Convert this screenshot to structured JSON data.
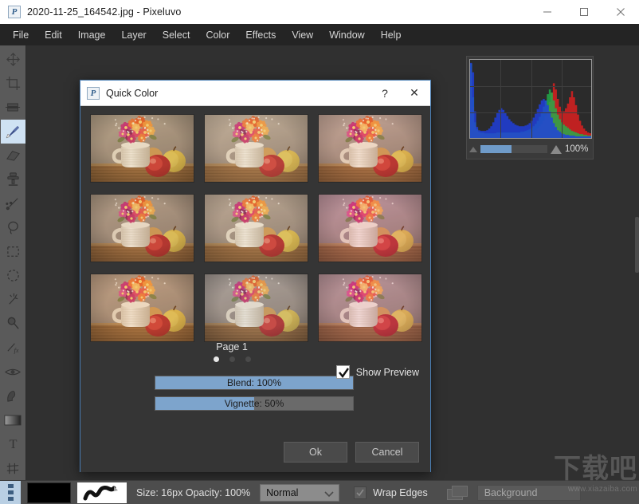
{
  "window": {
    "title": "2020-11-25_164542.jpg - Pixeluvo",
    "app_icon": "P",
    "minimize": "minimize-icon",
    "maximize": "maximize-icon",
    "close": "close-icon"
  },
  "menu": {
    "items": [
      {
        "label": "File"
      },
      {
        "label": "Edit"
      },
      {
        "label": "Image"
      },
      {
        "label": "Layer"
      },
      {
        "label": "Select"
      },
      {
        "label": "Color"
      },
      {
        "label": "Effects"
      },
      {
        "label": "View"
      },
      {
        "label": "Window"
      },
      {
        "label": "Help"
      }
    ]
  },
  "toolbar": {
    "tools": [
      {
        "name": "move-tool",
        "selected": false
      },
      {
        "name": "crop-tool",
        "selected": false
      },
      {
        "name": "transform-tool",
        "selected": false
      },
      {
        "name": "brush-tool",
        "selected": true
      },
      {
        "name": "eraser-tool",
        "selected": false
      },
      {
        "name": "clone-stamp-tool",
        "selected": false
      },
      {
        "name": "healing-tool",
        "selected": false
      },
      {
        "name": "lasso-tool",
        "selected": false
      },
      {
        "name": "rectangle-select-tool",
        "selected": false
      },
      {
        "name": "ellipse-select-tool",
        "selected": false
      },
      {
        "name": "magic-wand-tool",
        "selected": false
      },
      {
        "name": "zoom-tool",
        "selected": false
      },
      {
        "name": "effects-tool",
        "selected": false
      },
      {
        "name": "red-eye-tool",
        "selected": false
      },
      {
        "name": "smudge-tool",
        "selected": false
      },
      {
        "name": "gradient-tool",
        "selected": false
      },
      {
        "name": "text-tool",
        "selected": false
      },
      {
        "name": "path-tool",
        "selected": false
      }
    ]
  },
  "histogram": {
    "zoom_value": "100%",
    "zoom_fill_percent": 47,
    "chart_data": {
      "type": "area",
      "title": "",
      "xlabel": "",
      "ylabel": "",
      "xlim": [
        0,
        255
      ],
      "ylim": [
        0,
        100
      ],
      "grid": true,
      "legend": "none",
      "series": [
        {
          "name": "Red",
          "color": "#e02020",
          "values": [
            88,
            40,
            16,
            9,
            7,
            6,
            6,
            5,
            5,
            5,
            5,
            5,
            6,
            6,
            6,
            6,
            6,
            6,
            6,
            6,
            6,
            6,
            6,
            6,
            6,
            6,
            7,
            7,
            7,
            7,
            8,
            9,
            10,
            12,
            15,
            18,
            22,
            28,
            36,
            46,
            58,
            70,
            62,
            50,
            40,
            34,
            34,
            38,
            44,
            52,
            60,
            52,
            42,
            30,
            22,
            16,
            12,
            9,
            7,
            6
          ]
        },
        {
          "name": "Green",
          "color": "#22b04a",
          "values": [
            95,
            52,
            20,
            11,
            8,
            7,
            7,
            6,
            6,
            6,
            6,
            6,
            6,
            7,
            7,
            7,
            7,
            7,
            7,
            7,
            7,
            7,
            7,
            7,
            7,
            8,
            8,
            9,
            10,
            11,
            13,
            15,
            18,
            22,
            27,
            33,
            40,
            48,
            56,
            62,
            58,
            48,
            38,
            30,
            24,
            20,
            17,
            15,
            13,
            11,
            9,
            8,
            7,
            6,
            5,
            5,
            4,
            4,
            3,
            3
          ]
        },
        {
          "name": "Blue",
          "color": "#2040e0",
          "values": [
            96,
            84,
            34,
            14,
            10,
            9,
            9,
            9,
            10,
            12,
            15,
            20,
            26,
            32,
            36,
            38,
            36,
            32,
            28,
            24,
            21,
            19,
            17,
            16,
            15,
            15,
            15,
            16,
            17,
            19,
            22,
            26,
            31,
            37,
            43,
            48,
            50,
            48,
            42,
            34,
            26,
            19,
            14,
            10,
            8,
            6,
            5,
            4,
            4,
            3,
            3,
            3,
            2,
            2,
            2,
            2,
            2,
            2,
            2,
            2
          ]
        }
      ]
    }
  },
  "dialog": {
    "icon": "P",
    "title": "Quick Color",
    "help_label": "?",
    "close_label": "✕",
    "thumbnails": [
      {
        "name": "preset-1",
        "label": ""
      },
      {
        "name": "preset-2",
        "label": ""
      },
      {
        "name": "preset-3",
        "label": ""
      },
      {
        "name": "preset-4",
        "label": ""
      },
      {
        "name": "preset-5",
        "label": ""
      },
      {
        "name": "preset-6",
        "label": ""
      },
      {
        "name": "preset-7",
        "label": ""
      },
      {
        "name": "preset-8",
        "label": ""
      },
      {
        "name": "preset-9",
        "label": ""
      }
    ],
    "blend": {
      "label": "Blend: 100%",
      "value": 100
    },
    "vignette": {
      "label": "Vignette: 50%",
      "value": 50
    },
    "page_label": "Page 1",
    "page_count": 3,
    "page_active": 1,
    "show_preview": {
      "label": "Show Preview",
      "checked": true
    },
    "ok_label": "Ok",
    "cancel_label": "Cancel"
  },
  "statusbar": {
    "size_opacity": "Size: 16px  Opacity: 100%",
    "blend_mode": "Normal",
    "wrap_edges": {
      "label": "Wrap Edges",
      "checked": true
    },
    "layer_name": "Background",
    "foreground_color": "#000000"
  },
  "watermark": {
    "text_cn": "下载吧",
    "text_url": "www.xiazaiba.com"
  },
  "colors": {
    "accent": "#4a7fb5",
    "slider_fill": "#7da4cc",
    "panel_bg": "#353535",
    "toolbar_bg": "#5a5a5a",
    "canvas_bg": "#303030"
  }
}
